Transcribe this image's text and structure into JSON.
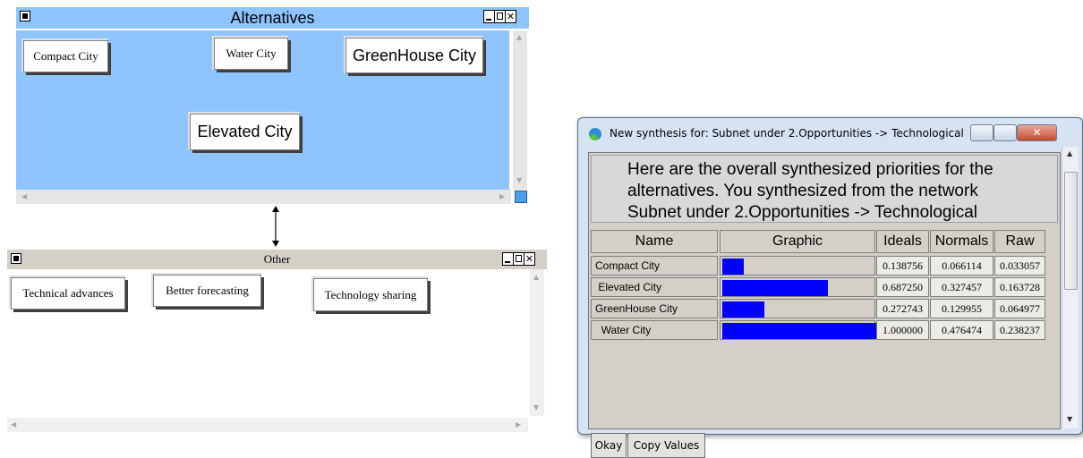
{
  "alt_window": {
    "title": "Alternatives",
    "bg": "#8ec5ff",
    "nodes": [
      "Compact City",
      "Water City",
      "GreenHouse City",
      "Elevated City"
    ]
  },
  "other_window": {
    "title": "Other",
    "nodes": [
      "Technical advances",
      "Better forecasting",
      "Technology sharing"
    ]
  },
  "dialog": {
    "title": "New synthesis for: Subnet under 2.Opportunities -> Technological",
    "message": [
      "Here are the overall synthesized priorities for the",
      "alternatives.  You synthesized from the network",
      "Subnet under 2.Opportunities -> Technological"
    ],
    "columns": [
      "Name",
      "Graphic",
      "Ideals",
      "Normals",
      "Raw"
    ],
    "rows": [
      {
        "name": "Compact City",
        "ideal": "0.138756",
        "normal": "0.066114",
        "raw": "0.033057",
        "ideal_value": 0.138756
      },
      {
        "name": " Elevated City",
        "ideal": "0.687250",
        "normal": "0.327457",
        "raw": "0.163728",
        "ideal_value": 0.68725
      },
      {
        "name": "GreenHouse City",
        "ideal": "0.272743",
        "normal": "0.129955",
        "raw": "0.064977",
        "ideal_value": 0.272743
      },
      {
        "name": "  Water City",
        "ideal": "1.000000",
        "normal": "0.476474",
        "raw": "0.238237",
        "ideal_value": 1.0
      }
    ],
    "bar_color": "#0000ff",
    "buttons": [
      "Okay",
      "Copy Values"
    ]
  }
}
